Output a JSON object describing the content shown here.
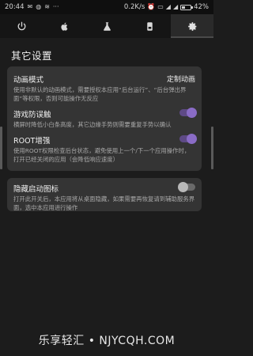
{
  "status_bar": {
    "time": "20:44",
    "network_speed": "0.2K/s",
    "battery": "42%",
    "battery_fraction": 0.42,
    "icons": [
      "message-icon",
      "chat-icon",
      "wifi-icon",
      "more-icon",
      "alarm-icon",
      "vpn-icon",
      "signal-icon",
      "signal-icon",
      "battery-icon"
    ]
  },
  "tabs": [
    {
      "icon": "power-icon",
      "active": false
    },
    {
      "icon": "apple-icon",
      "active": false
    },
    {
      "icon": "flask-icon",
      "active": false
    },
    {
      "icon": "device-icon",
      "active": false
    },
    {
      "icon": "gear-icon",
      "active": true
    }
  ],
  "section": {
    "title": "其它设置"
  },
  "settings": {
    "animation": {
      "title": "动画模式",
      "value": "定制动画",
      "desc": "使用非默认的动画模式，需要授权本应用“后台运行”、“后台弹出界面”等权限，否则可能操作无反应"
    },
    "anti_mistouch": {
      "title": "游戏防误触",
      "desc": "横屏时降低小白条高度，其它边缘手势则需要重复手势以确认",
      "enabled": true
    },
    "root": {
      "title": "ROOT增强",
      "desc": "使用ROOT权限检查后台状态，避免使用上一个/下一个应用操作时，打开已经关闭的应用（会降低响应速度）",
      "enabled": true
    },
    "hide_icon": {
      "title": "隐藏启动图标",
      "desc": "打开此开关后，本应用将从桌面隐藏，如果需要再恢复请到辅助服务界面，选中本应用进行操作",
      "enabled": false
    }
  },
  "colors": {
    "accent": "#8a6cc6",
    "card": "#343434",
    "background": "#1c1c1c"
  },
  "watermark": "乐享轻汇 • NJYCQH.COM"
}
